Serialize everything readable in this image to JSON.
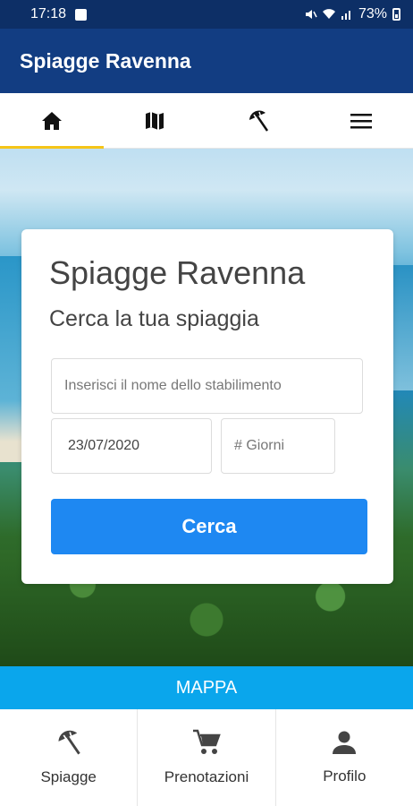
{
  "status_bar": {
    "time": "17:18",
    "battery": "73%"
  },
  "app_bar": {
    "title": "Spiagge Ravenna"
  },
  "top_nav": {
    "tabs": [
      {
        "icon": "home-icon",
        "active": true
      },
      {
        "icon": "map-icon",
        "active": false
      },
      {
        "icon": "beach-umbrella-icon",
        "active": false
      },
      {
        "icon": "menu-icon",
        "active": false
      }
    ],
    "active_color": "#f5c518"
  },
  "search_card": {
    "title": "Spiagge Ravenna",
    "subtitle": "Cerca la tua spiaggia",
    "name_placeholder": "Inserisci il nome dello stabilimento",
    "date_value": "23/07/2020",
    "days_placeholder": "# Giorni",
    "search_label": "Cerca"
  },
  "map_bar": {
    "label": "MAPPA"
  },
  "bottom_nav": {
    "items": [
      {
        "icon": "beach-umbrella-icon",
        "label": "Spiagge"
      },
      {
        "icon": "cart-icon",
        "label": "Prenotazioni"
      },
      {
        "icon": "person-icon",
        "label": "Profilo"
      }
    ]
  },
  "colors": {
    "status_bar": "#0d2f66",
    "app_bar": "#123d82",
    "button": "#1e88f2",
    "map_bar": "#0aa6ec"
  }
}
